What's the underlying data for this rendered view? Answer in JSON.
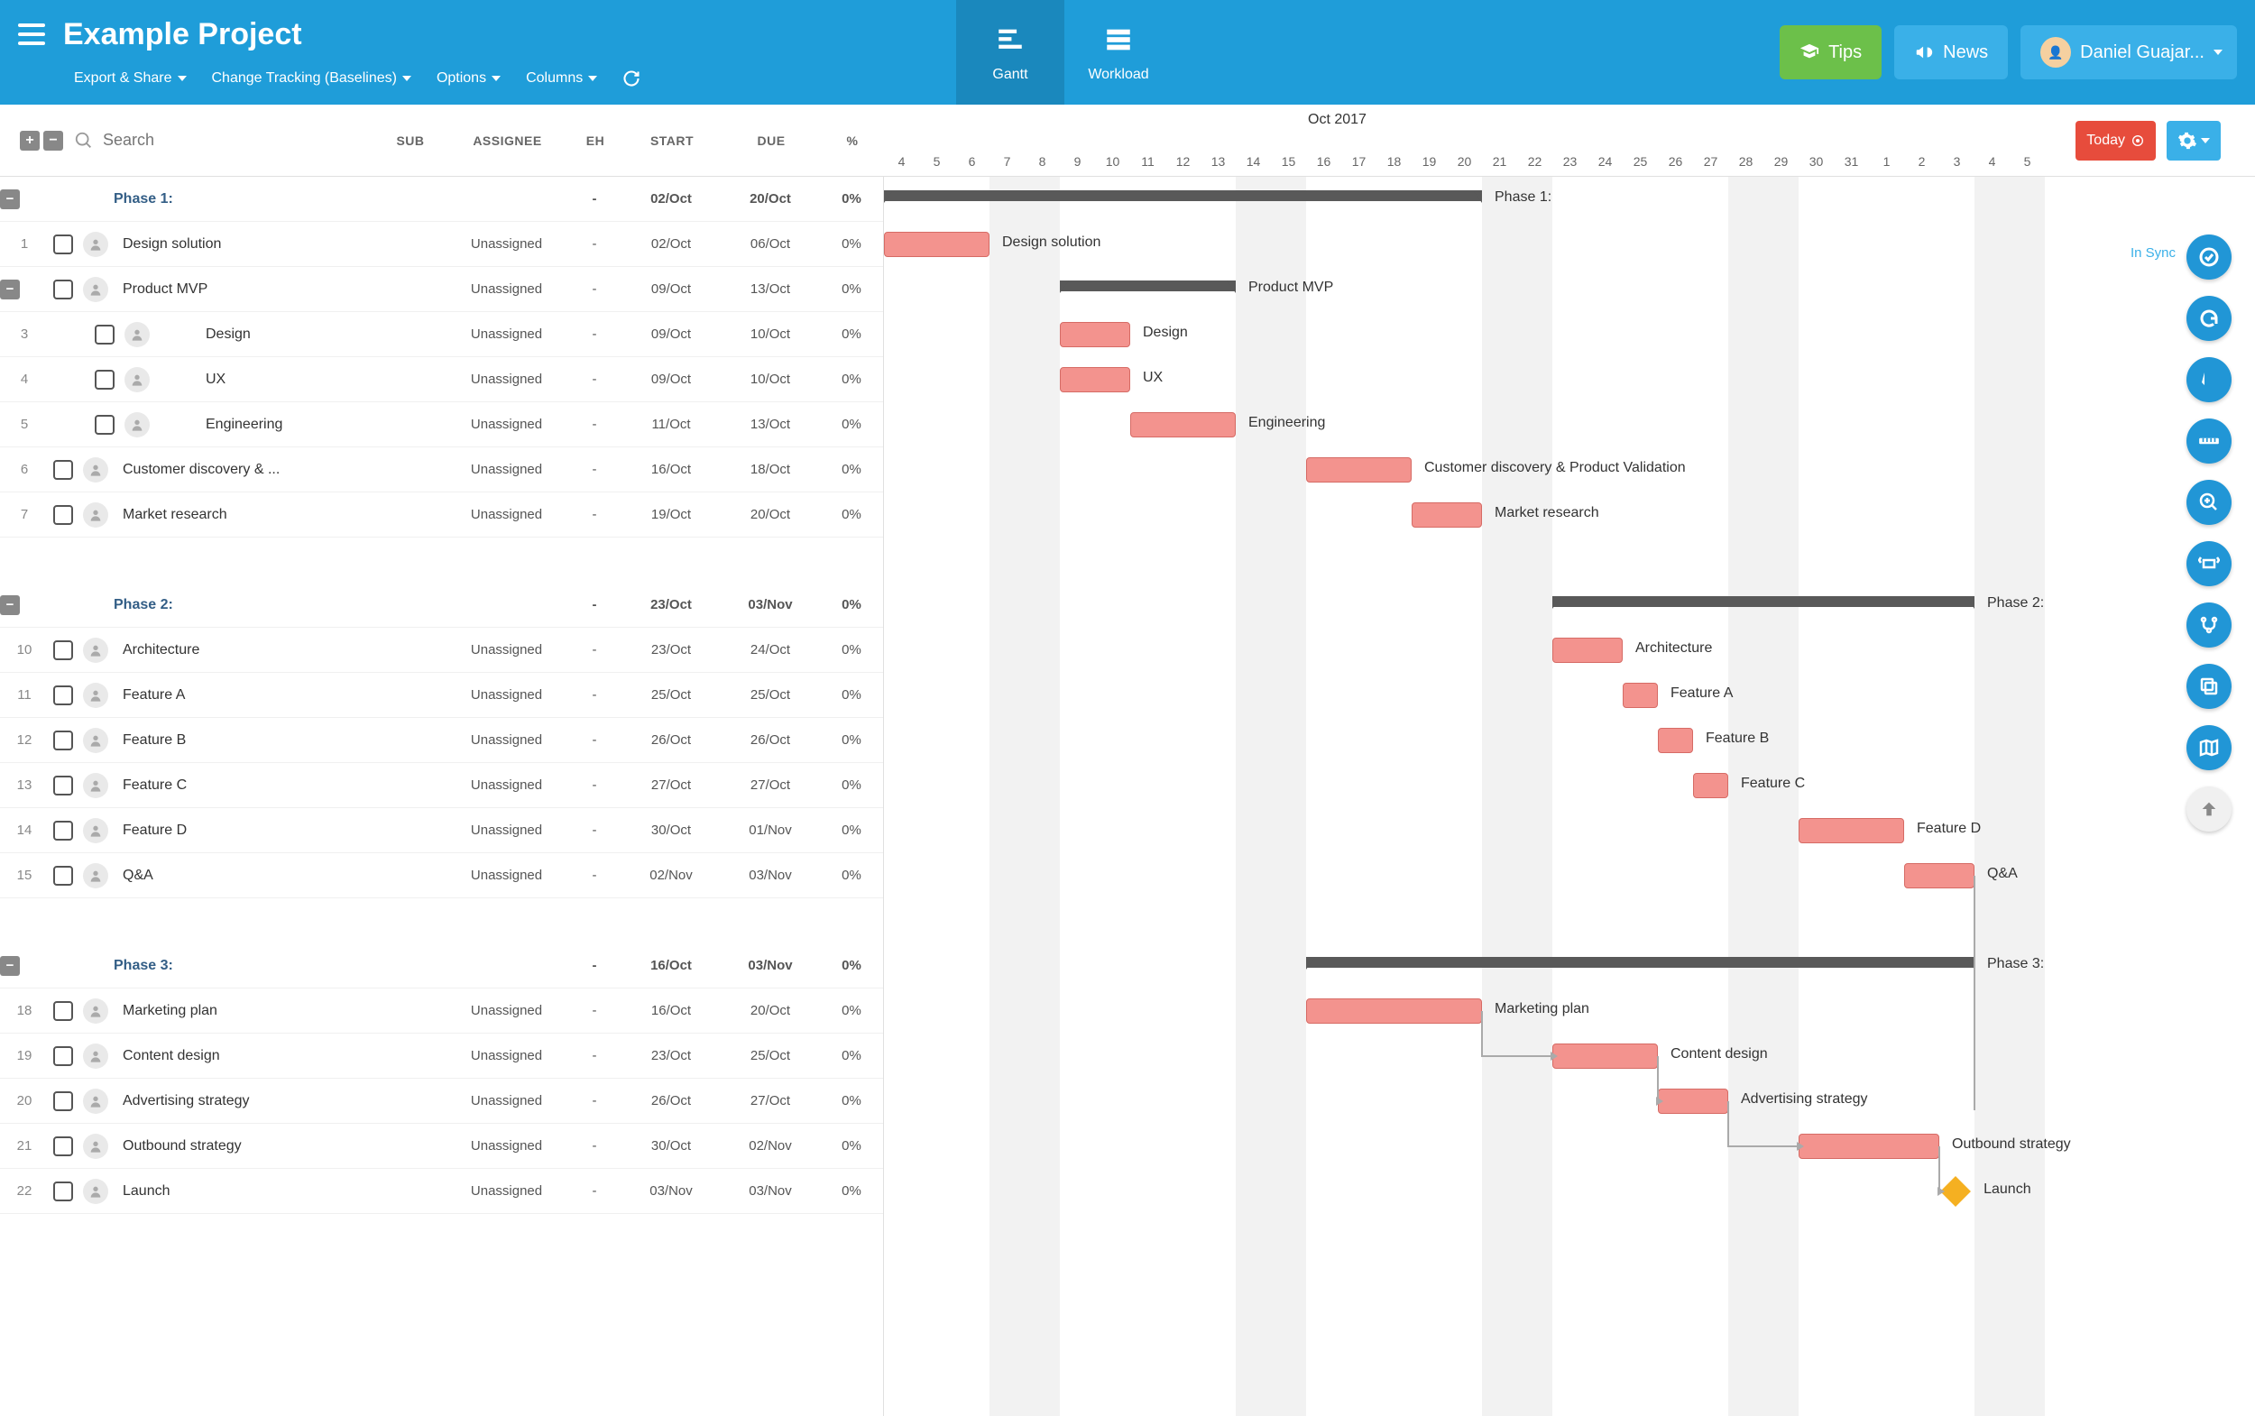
{
  "header": {
    "title": "Example Project",
    "toolbar": {
      "export": "Export & Share",
      "tracking": "Change Tracking (Baselines)",
      "options": "Options",
      "columns": "Columns"
    },
    "tabs": {
      "gantt": "Gantt",
      "workload": "Workload"
    },
    "tips": "Tips",
    "news": "News",
    "user": "Daniel Guajar..."
  },
  "search": {
    "placeholder": "Search"
  },
  "columns": {
    "sub": "SUB",
    "assignee": "ASSIGNEE",
    "eh": "EH",
    "start": "START",
    "due": "DUE",
    "pct": "%"
  },
  "timeline": {
    "month": "Oct 2017",
    "days": [
      "4",
      "5",
      "6",
      "7",
      "8",
      "9",
      "10",
      "11",
      "12",
      "13",
      "14",
      "15",
      "16",
      "17",
      "18",
      "19",
      "20",
      "21",
      "22",
      "23",
      "24",
      "25",
      "26",
      "27",
      "28",
      "29",
      "30",
      "31",
      "1",
      "2",
      "3",
      "4",
      "5"
    ]
  },
  "today_btn": "Today",
  "sync_label": "In Sync",
  "phases": [
    {
      "id": "p1",
      "name": "Phase 1:",
      "sub": "-",
      "eh": "-",
      "start": "02/Oct",
      "due": "20/Oct",
      "pct": "0%",
      "bar_start": 0,
      "bar_end": 17,
      "label": "Phase 1:"
    },
    {
      "id": "p2",
      "name": "Phase 2:",
      "sub": "-",
      "eh": "-",
      "start": "23/Oct",
      "due": "03/Nov",
      "pct": "0%",
      "bar_start": 19,
      "bar_end": 31,
      "label": "Phase 2:"
    },
    {
      "id": "p3",
      "name": "Phase 3:",
      "sub": "-",
      "eh": "-",
      "start": "16/Oct",
      "due": "03/Nov",
      "pct": "0%",
      "bar_start": 12,
      "bar_end": 31,
      "label": "Phase 3:"
    }
  ],
  "tasks": [
    {
      "n": "1",
      "phase": 0,
      "name": "Design solution",
      "assignee": "Unassigned",
      "eh": "-",
      "start": "02/Oct",
      "due": "06/Oct",
      "pct": "0%",
      "indent": 0,
      "bs": 0,
      "be": 3,
      "label": "Design solution"
    },
    {
      "n": "",
      "phase": 0,
      "name": "Product MVP",
      "assignee": "Unassigned",
      "eh": "-",
      "start": "09/Oct",
      "due": "13/Oct",
      "pct": "0%",
      "indent": 0,
      "bs": 5,
      "be": 10,
      "label": "Product MVP",
      "summary": true
    },
    {
      "n": "3",
      "phase": 0,
      "name": "Design",
      "assignee": "Unassigned",
      "eh": "-",
      "start": "09/Oct",
      "due": "10/Oct",
      "pct": "0%",
      "indent": 1,
      "bs": 5,
      "be": 7,
      "label": "Design"
    },
    {
      "n": "4",
      "phase": 0,
      "name": "UX",
      "assignee": "Unassigned",
      "eh": "-",
      "start": "09/Oct",
      "due": "10/Oct",
      "pct": "0%",
      "indent": 1,
      "bs": 5,
      "be": 7,
      "label": "UX"
    },
    {
      "n": "5",
      "phase": 0,
      "name": "Engineering",
      "assignee": "Unassigned",
      "eh": "-",
      "start": "11/Oct",
      "due": "13/Oct",
      "pct": "0%",
      "indent": 1,
      "bs": 7,
      "be": 10,
      "label": "Engineering"
    },
    {
      "n": "6",
      "phase": 0,
      "name": "Customer discovery & ...",
      "assignee": "Unassigned",
      "eh": "-",
      "start": "16/Oct",
      "due": "18/Oct",
      "pct": "0%",
      "indent": 0,
      "bs": 12,
      "be": 15,
      "label": "Customer discovery & Product Validation"
    },
    {
      "n": "7",
      "phase": 0,
      "name": "Market research",
      "assignee": "Unassigned",
      "eh": "-",
      "start": "19/Oct",
      "due": "20/Oct",
      "pct": "0%",
      "indent": 0,
      "bs": 15,
      "be": 17,
      "label": "Market research"
    },
    {
      "n": "10",
      "phase": 1,
      "name": "Architecture",
      "assignee": "Unassigned",
      "eh": "-",
      "start": "23/Oct",
      "due": "24/Oct",
      "pct": "0%",
      "indent": 0,
      "bs": 19,
      "be": 21,
      "label": "Architecture"
    },
    {
      "n": "11",
      "phase": 1,
      "name": "Feature A",
      "assignee": "Unassigned",
      "eh": "-",
      "start": "25/Oct",
      "due": "25/Oct",
      "pct": "0%",
      "indent": 0,
      "bs": 21,
      "be": 22,
      "label": "Feature A"
    },
    {
      "n": "12",
      "phase": 1,
      "name": "Feature B",
      "assignee": "Unassigned",
      "eh": "-",
      "start": "26/Oct",
      "due": "26/Oct",
      "pct": "0%",
      "indent": 0,
      "bs": 22,
      "be": 23,
      "label": "Feature B"
    },
    {
      "n": "13",
      "phase": 1,
      "name": "Feature C",
      "assignee": "Unassigned",
      "eh": "-",
      "start": "27/Oct",
      "due": "27/Oct",
      "pct": "0%",
      "indent": 0,
      "bs": 23,
      "be": 24,
      "label": "Feature C"
    },
    {
      "n": "14",
      "phase": 1,
      "name": "Feature D",
      "assignee": "Unassigned",
      "eh": "-",
      "start": "30/Oct",
      "due": "01/Nov",
      "pct": "0%",
      "indent": 0,
      "bs": 26,
      "be": 29,
      "label": "Feature D"
    },
    {
      "n": "15",
      "phase": 1,
      "name": "Q&A",
      "assignee": "Unassigned",
      "eh": "-",
      "start": "02/Nov",
      "due": "03/Nov",
      "pct": "0%",
      "indent": 0,
      "bs": 29,
      "be": 31,
      "label": "Q&A"
    },
    {
      "n": "18",
      "phase": 2,
      "name": "Marketing plan",
      "assignee": "Unassigned",
      "eh": "-",
      "start": "16/Oct",
      "due": "20/Oct",
      "pct": "0%",
      "indent": 0,
      "bs": 12,
      "be": 17,
      "label": "Marketing plan"
    },
    {
      "n": "19",
      "phase": 2,
      "name": "Content design",
      "assignee": "Unassigned",
      "eh": "-",
      "start": "23/Oct",
      "due": "25/Oct",
      "pct": "0%",
      "indent": 0,
      "bs": 19,
      "be": 22,
      "label": "Content design"
    },
    {
      "n": "20",
      "phase": 2,
      "name": "Advertising strategy",
      "assignee": "Unassigned",
      "eh": "-",
      "start": "26/Oct",
      "due": "27/Oct",
      "pct": "0%",
      "indent": 0,
      "bs": 22,
      "be": 24,
      "label": "Advertising strategy"
    },
    {
      "n": "21",
      "phase": 2,
      "name": "Outbound strategy",
      "assignee": "Unassigned",
      "eh": "-",
      "start": "30/Oct",
      "due": "02/Nov",
      "pct": "0%",
      "indent": 0,
      "bs": 26,
      "be": 30,
      "label": "Outbound strategy"
    },
    {
      "n": "22",
      "phase": 2,
      "name": "Launch",
      "assignee": "Unassigned",
      "eh": "-",
      "start": "03/Nov",
      "due": "03/Nov",
      "pct": "0%",
      "indent": 0,
      "bs": 30,
      "be": 30,
      "label": "Launch",
      "milestone": true
    }
  ],
  "chart_data": {
    "type": "gantt",
    "x_unit": "day",
    "x_origin": "2017-10-04",
    "x_range": [
      "2017-10-04",
      "2017-11-05"
    ],
    "phases": [
      {
        "name": "Phase 1:",
        "start": "2017-10-02",
        "end": "2017-10-20"
      },
      {
        "name": "Phase 2:",
        "start": "2017-10-23",
        "end": "2017-11-03"
      },
      {
        "name": "Phase 3:",
        "start": "2017-10-16",
        "end": "2017-11-03"
      }
    ],
    "tasks": [
      {
        "name": "Design solution",
        "start": "2017-10-02",
        "end": "2017-10-06"
      },
      {
        "name": "Product MVP",
        "start": "2017-10-09",
        "end": "2017-10-13",
        "summary": true
      },
      {
        "name": "Design",
        "start": "2017-10-09",
        "end": "2017-10-10"
      },
      {
        "name": "UX",
        "start": "2017-10-09",
        "end": "2017-10-10"
      },
      {
        "name": "Engineering",
        "start": "2017-10-11",
        "end": "2017-10-13"
      },
      {
        "name": "Customer discovery & Product Validation",
        "start": "2017-10-16",
        "end": "2017-10-18"
      },
      {
        "name": "Market research",
        "start": "2017-10-19",
        "end": "2017-10-20"
      },
      {
        "name": "Architecture",
        "start": "2017-10-23",
        "end": "2017-10-24"
      },
      {
        "name": "Feature A",
        "start": "2017-10-25",
        "end": "2017-10-25"
      },
      {
        "name": "Feature B",
        "start": "2017-10-26",
        "end": "2017-10-26"
      },
      {
        "name": "Feature C",
        "start": "2017-10-27",
        "end": "2017-10-27"
      },
      {
        "name": "Feature D",
        "start": "2017-10-30",
        "end": "2017-11-01"
      },
      {
        "name": "Q&A",
        "start": "2017-11-02",
        "end": "2017-11-03"
      },
      {
        "name": "Marketing plan",
        "start": "2017-10-16",
        "end": "2017-10-20"
      },
      {
        "name": "Content design",
        "start": "2017-10-23",
        "end": "2017-10-25"
      },
      {
        "name": "Advertising strategy",
        "start": "2017-10-26",
        "end": "2017-10-27"
      },
      {
        "name": "Outbound strategy",
        "start": "2017-10-30",
        "end": "2017-11-02"
      },
      {
        "name": "Launch",
        "start": "2017-11-03",
        "end": "2017-11-03",
        "milestone": true
      }
    ]
  }
}
